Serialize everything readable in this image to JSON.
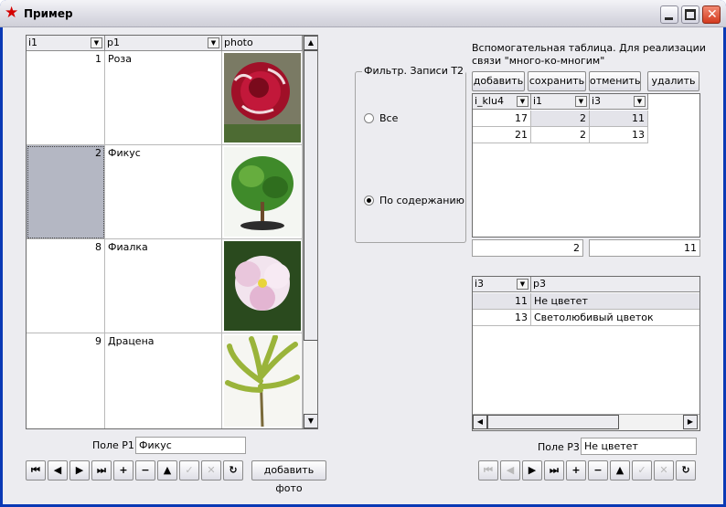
{
  "window": {
    "title": "Пример",
    "icon": "red-star-icon"
  },
  "grid1": {
    "columns": [
      "i1",
      "p1",
      "photo"
    ],
    "rows": [
      {
        "i1": "1",
        "p1": "Роза",
        "photo": "rose-photo"
      },
      {
        "i1": "2",
        "p1": "Фикус",
        "photo": "ficus-photo"
      },
      {
        "i1": "8",
        "p1": "Фиалка",
        "photo": "violet-photo"
      },
      {
        "i1": "9",
        "p1": "Драцена",
        "photo": "dracaena-photo"
      }
    ],
    "selected_row": 1
  },
  "field_p1": {
    "label": "Поле P1:",
    "value": "Фикус"
  },
  "add_photo_label": "добавить фото",
  "filter": {
    "title": "Фильтр. Записи Т2",
    "options": [
      "Все",
      "По содержанию"
    ],
    "selected": 1
  },
  "aux": {
    "caption": "Вспомогательная таблица. Для реализации связи \"много-ко-многим\"",
    "buttons": [
      "добавить",
      "сохранить",
      "отменить",
      "удалить"
    ],
    "columns": [
      "i_klu4",
      "i1",
      "i3"
    ],
    "rows": [
      [
        "17",
        "2",
        "11"
      ],
      [
        "21",
        "2",
        "13"
      ]
    ],
    "field_a": "2",
    "field_b": "11"
  },
  "grid3": {
    "columns": [
      "i3",
      "p3"
    ],
    "rows": [
      [
        "11",
        "Не цветет"
      ],
      [
        "13",
        "Светолюбивый цветок"
      ]
    ]
  },
  "field_p3": {
    "label": "Поле P3:",
    "value": "Не цветет"
  },
  "nav_icons": [
    "first-icon",
    "prior-icon",
    "next-icon",
    "last-icon",
    "insert-icon",
    "delete-icon",
    "edit-icon",
    "post-icon",
    "cancel-icon",
    "refresh-icon"
  ],
  "colors": {
    "selection": "#b4b7c3",
    "title_bg": "#e4e4ea",
    "client_bg": "#ececf0"
  }
}
